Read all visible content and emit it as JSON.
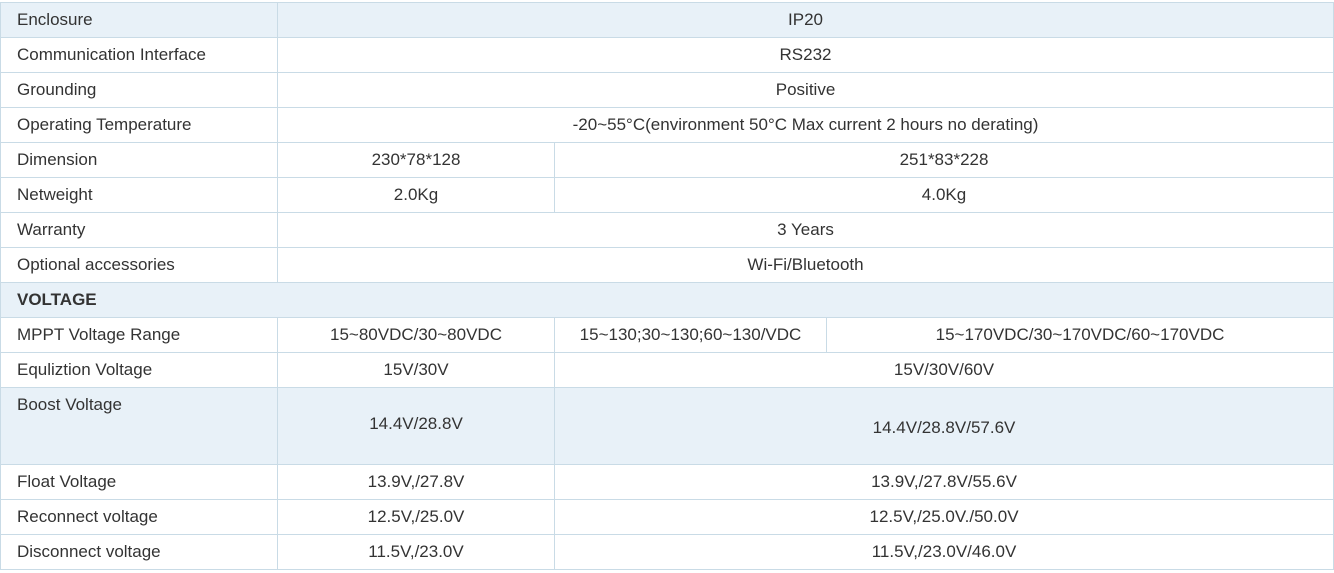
{
  "general": [
    {
      "label": "Enclosure",
      "value": "IP20"
    },
    {
      "label": "Communication Interface",
      "value": "RS232"
    },
    {
      "label": "Grounding",
      "value": "Positive"
    },
    {
      "label": "Operating Temperature",
      "value": "-20~55°C(environment 50°C Max current 2 hours no derating)"
    },
    {
      "label": "Dimension",
      "values": [
        "230*78*128",
        "251*83*228"
      ]
    },
    {
      "label": "Netweight",
      "values": [
        "2.0Kg",
        "4.0Kg"
      ]
    },
    {
      "label": "Warranty",
      "value": "3 Years"
    },
    {
      "label": "Optional accessories",
      "value": "Wi-Fi/Bluetooth"
    }
  ],
  "voltage": {
    "heading": "VOLTAGE",
    "rows": [
      {
        "label": "MPPT Voltage Range",
        "values": [
          "15~80VDC/30~80VDC",
          "15~130;30~130;60~130/VDC",
          "15~170VDC/30~170VDC/60~170VDC"
        ]
      },
      {
        "label": "Equliztion Voltage",
        "values": [
          "15V/30V",
          "15V/30V/60V"
        ]
      },
      {
        "label": "Boost Voltage",
        "values": [
          "14.4V/28.8V",
          "14.4V/28.8V/57.6V"
        ]
      },
      {
        "label": "Float Voltage",
        "values": [
          "13.9V,/27.8V",
          "13.9V,/27.8V/55.6V"
        ]
      },
      {
        "label": "Reconnect voltage",
        "values": [
          "12.5V,/25.0V",
          "12.5V,/25.0V./50.0V"
        ]
      },
      {
        "label": "Disconnect voltage",
        "values": [
          "11.5V,/23.0V",
          "11.5V,/23.0V/46.0V"
        ]
      }
    ]
  }
}
